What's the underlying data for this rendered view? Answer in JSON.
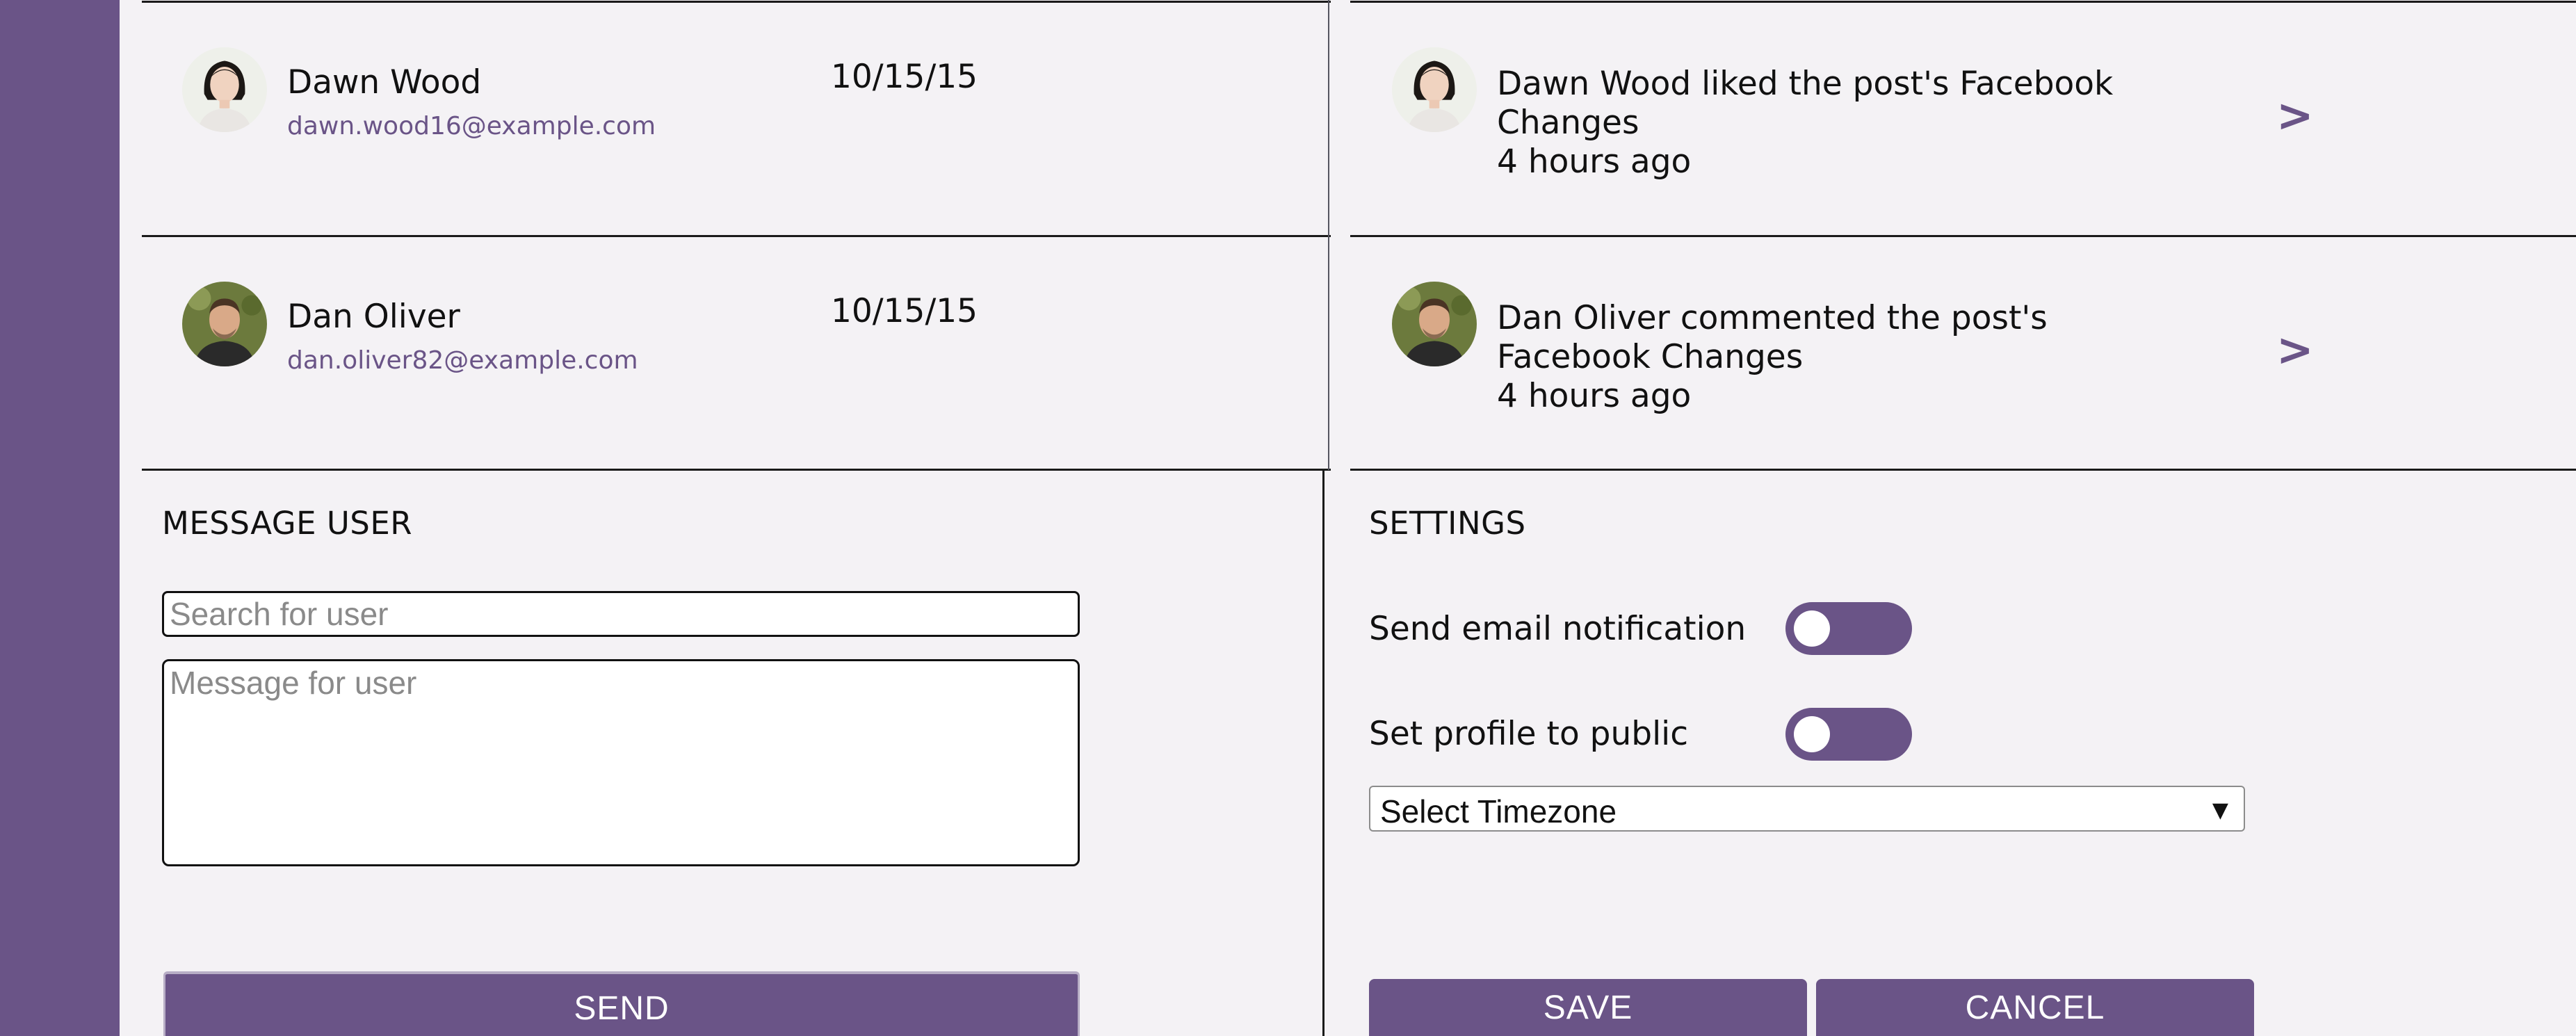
{
  "members": [
    {
      "name": "Dawn Wood",
      "email": "dawn.wood16@example.com",
      "date": "10/15/15",
      "avatar": "woman-avatar"
    },
    {
      "name": "Dan Oliver",
      "email": "dan.oliver82@example.com",
      "date": "10/15/15",
      "avatar": "man-avatar"
    }
  ],
  "activity": [
    {
      "text": "Dawn Wood liked the post's Facebook Changes",
      "time": "4 hours ago",
      "chevron": ">",
      "avatar": "woman-avatar"
    },
    {
      "text": "Dan Oliver commented the post's Facebook Changes",
      "time": "4 hours ago",
      "chevron": ">",
      "avatar": "man-avatar"
    }
  ],
  "message_user": {
    "title": "MESSAGE USER",
    "search_placeholder": "Search for user",
    "message_placeholder": "Message for user",
    "send_label": "SEND"
  },
  "settings": {
    "title": "SETTINGS",
    "email_notification_label": "Send email notification",
    "email_notification_on": false,
    "public_profile_label": "Set profile to public",
    "public_profile_on": false,
    "timezone_selected": "Select Timezone",
    "timezone_arrow": "▼",
    "save_label": "SAVE",
    "cancel_label": "CANCEL"
  },
  "colors": {
    "accent": "#6a5487",
    "background": "#f4f2f5"
  }
}
